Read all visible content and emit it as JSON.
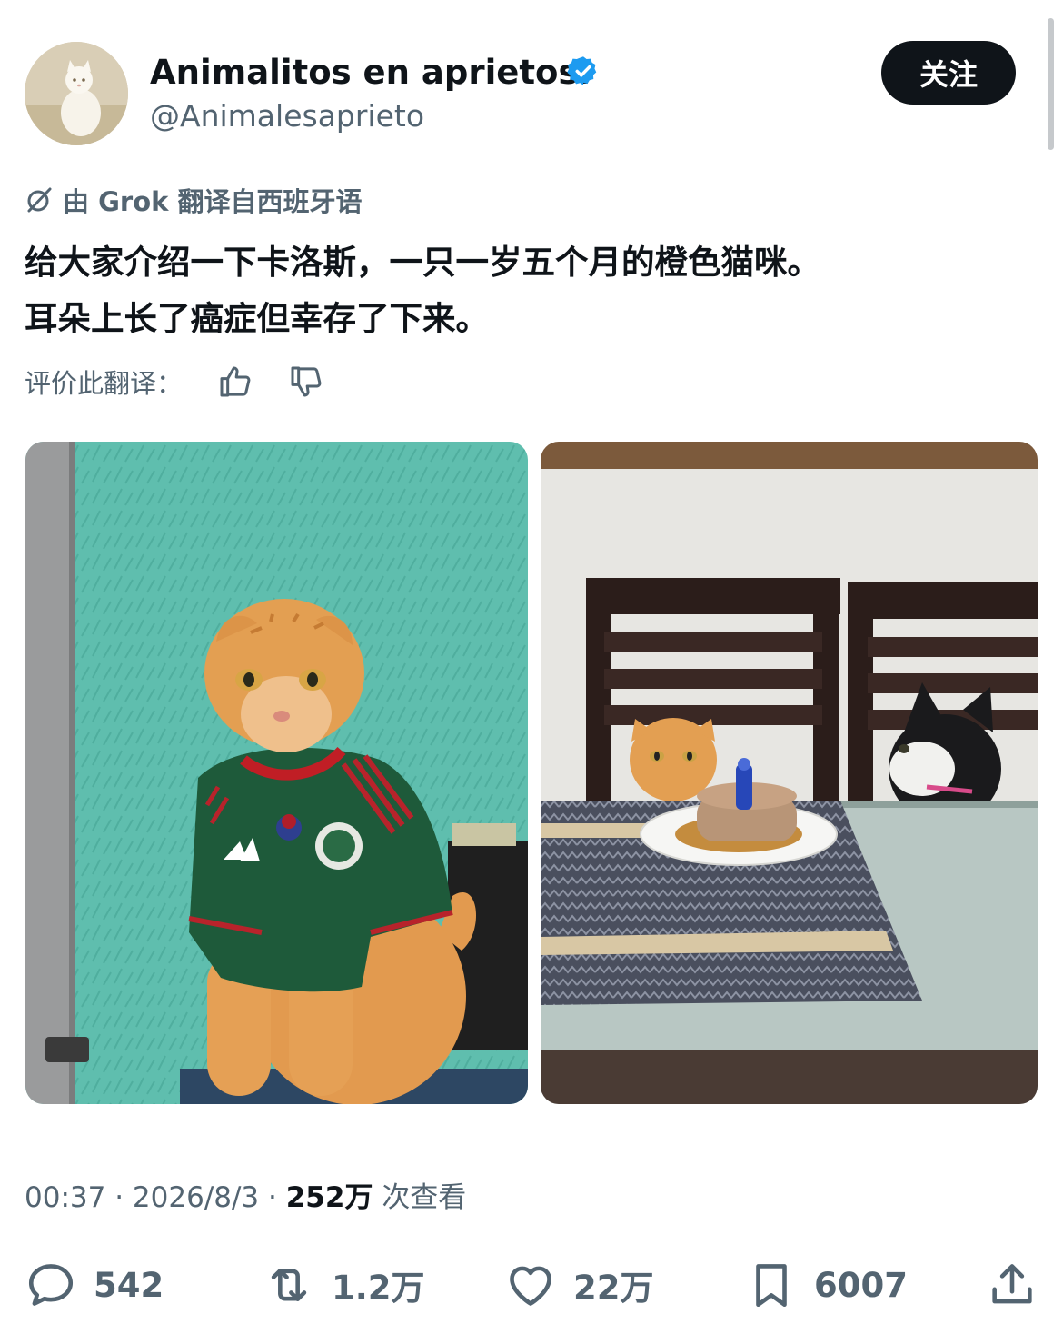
{
  "author": {
    "display_name": "Animalitos en aprietos.",
    "handle": "@Animalesaprieto",
    "verified": true,
    "verified_color": "#1d9bf0"
  },
  "follow_button": {
    "label": "关注"
  },
  "translation": {
    "notice": "由 Grok 翻译自西班牙语",
    "icon": "grok-icon",
    "rate_label": "评价此翻译："
  },
  "tweet": {
    "lines": [
      "给大家介绍一下卡洛斯，一只一岁五个月的橙色猫咪。",
      "耳朵上长了癌症但幸存了下来。"
    ]
  },
  "media": [
    {
      "icon": "photo-cat-in-mexico-jersey"
    },
    {
      "icon": "photo-cat-birthday-cake"
    }
  ],
  "meta": {
    "time": "00:37",
    "sep": "·",
    "date": "2026/8/3",
    "views_count": "252万",
    "views_label": "次查看"
  },
  "actions": {
    "replies": "542",
    "retweets": "1.2万",
    "likes": "22万",
    "bookmarks": "6007"
  },
  "colors": {
    "text": "#0f1419",
    "secondary": "#536471",
    "follow_bg": "#0f1419"
  }
}
